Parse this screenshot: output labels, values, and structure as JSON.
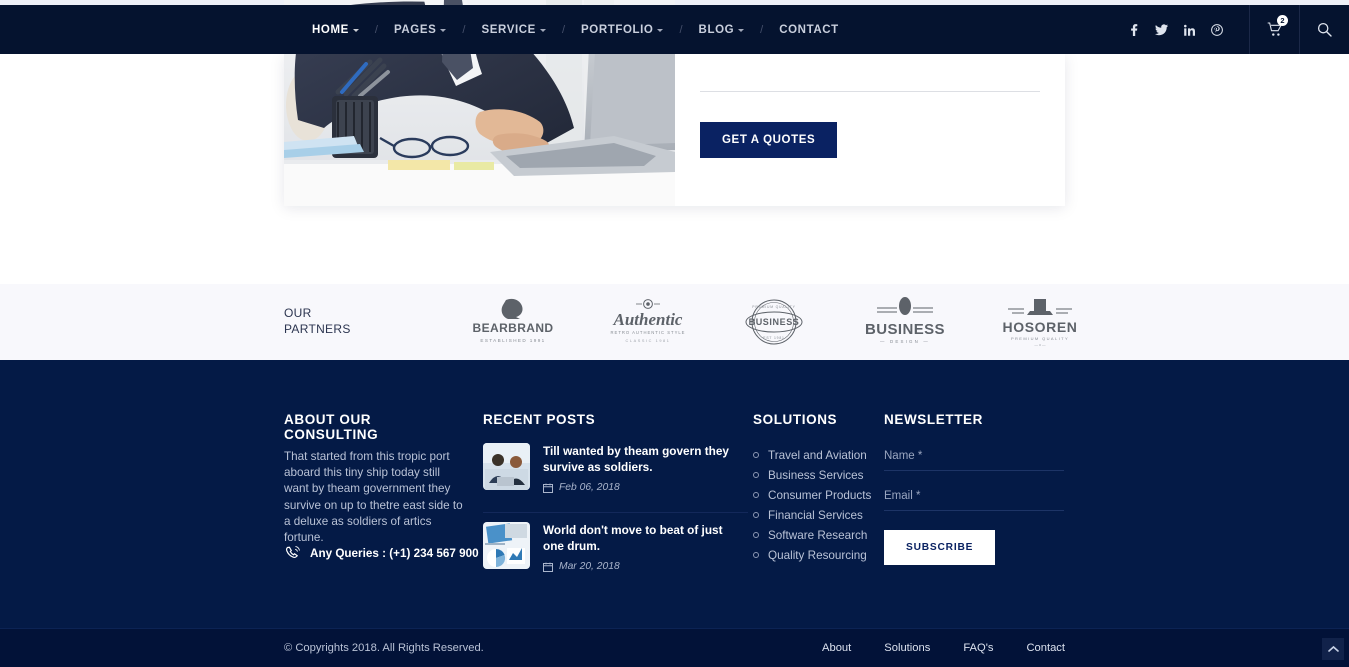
{
  "header": {
    "nav": [
      {
        "label": "HOME",
        "has_caret": true,
        "active": true
      },
      {
        "label": "PAGES",
        "has_caret": true,
        "active": false
      },
      {
        "label": "SERVICE",
        "has_caret": true,
        "active": false
      },
      {
        "label": "PORTFOLIO",
        "has_caret": true,
        "active": false
      },
      {
        "label": "BLOG",
        "has_caret": true,
        "active": false
      },
      {
        "label": "CONTACT",
        "has_caret": false,
        "active": false
      }
    ],
    "separator": "/",
    "socials": [
      {
        "name": "facebook-icon"
      },
      {
        "name": "twitter-icon"
      },
      {
        "name": "linkedin-icon"
      },
      {
        "name": "pinterest-icon"
      }
    ],
    "cart": {
      "icon": "cart-icon",
      "badge": "2"
    },
    "search": {
      "icon": "search-icon"
    },
    "bar_color": "#05132f"
  },
  "hero": {
    "image_alt": "businessman-typing-on-laptop",
    "quote_button": "GET A QUOTES",
    "button_color": "#0a2262"
  },
  "partners": {
    "title_line1": "OUR",
    "title_line2": "PARTNERS",
    "logos": [
      {
        "name": "bearbrand-logo",
        "text": "BEARBRAND",
        "sub": "ESTABLISHED 1991"
      },
      {
        "name": "authentic-logo",
        "text": "Authentic",
        "sub": "RETRO AUTHENTIC STYLE"
      },
      {
        "name": "business-badge-logo",
        "text": "BUSINESS",
        "sub": "PREMIUM QUALITY"
      },
      {
        "name": "business-design-logo",
        "text": "BUSINESS",
        "sub": "DESIGN"
      },
      {
        "name": "hosoren-logo",
        "text": "HOSOREN",
        "sub": "PREMIUM QUALITY"
      }
    ],
    "background": "#f8f8fc"
  },
  "footer": {
    "background": "#041a46",
    "about": {
      "title": "ABOUT OUR CONSULTING",
      "text": "That started from this tropic port aboard this tiny ship today still want by theam government they survive on up to thetre east side to a deluxe as soldiers of artics fortune.",
      "queries_icon": "phone-icon",
      "queries": "Any Queries : (+1) 234 567 900"
    },
    "recent_posts": {
      "title": "RECENT POSTS",
      "posts": [
        {
          "title": "Till wanted by theam govern they survive as soldiers.",
          "date": "Feb 06, 2018",
          "date_icon": "calendar-icon",
          "thumb": "two-people-with-laptop"
        },
        {
          "title": "World don't move to beat of just one drum.",
          "date": "Mar 20, 2018",
          "date_icon": "calendar-icon",
          "thumb": "charts-and-documents"
        }
      ]
    },
    "solutions": {
      "title": "SOLUTIONS",
      "items": [
        "Travel and Aviation",
        "Business Services",
        "Consumer Products",
        "Financial Services",
        "Software Research",
        "Quality Resourcing"
      ]
    },
    "newsletter": {
      "title": "NEWSLETTER",
      "name_placeholder": "Name *",
      "name_value": "",
      "email_placeholder": "Email *",
      "email_value": "",
      "subscribe_label": "SUBSCRIBE"
    }
  },
  "bottombar": {
    "copyright": "© Copyrights 2018. All Rights Reserved.",
    "links": [
      "About",
      "Solutions",
      "FAQ's",
      "Contact"
    ],
    "background": "#021238",
    "to_top_icon": "chevron-up-icon"
  }
}
